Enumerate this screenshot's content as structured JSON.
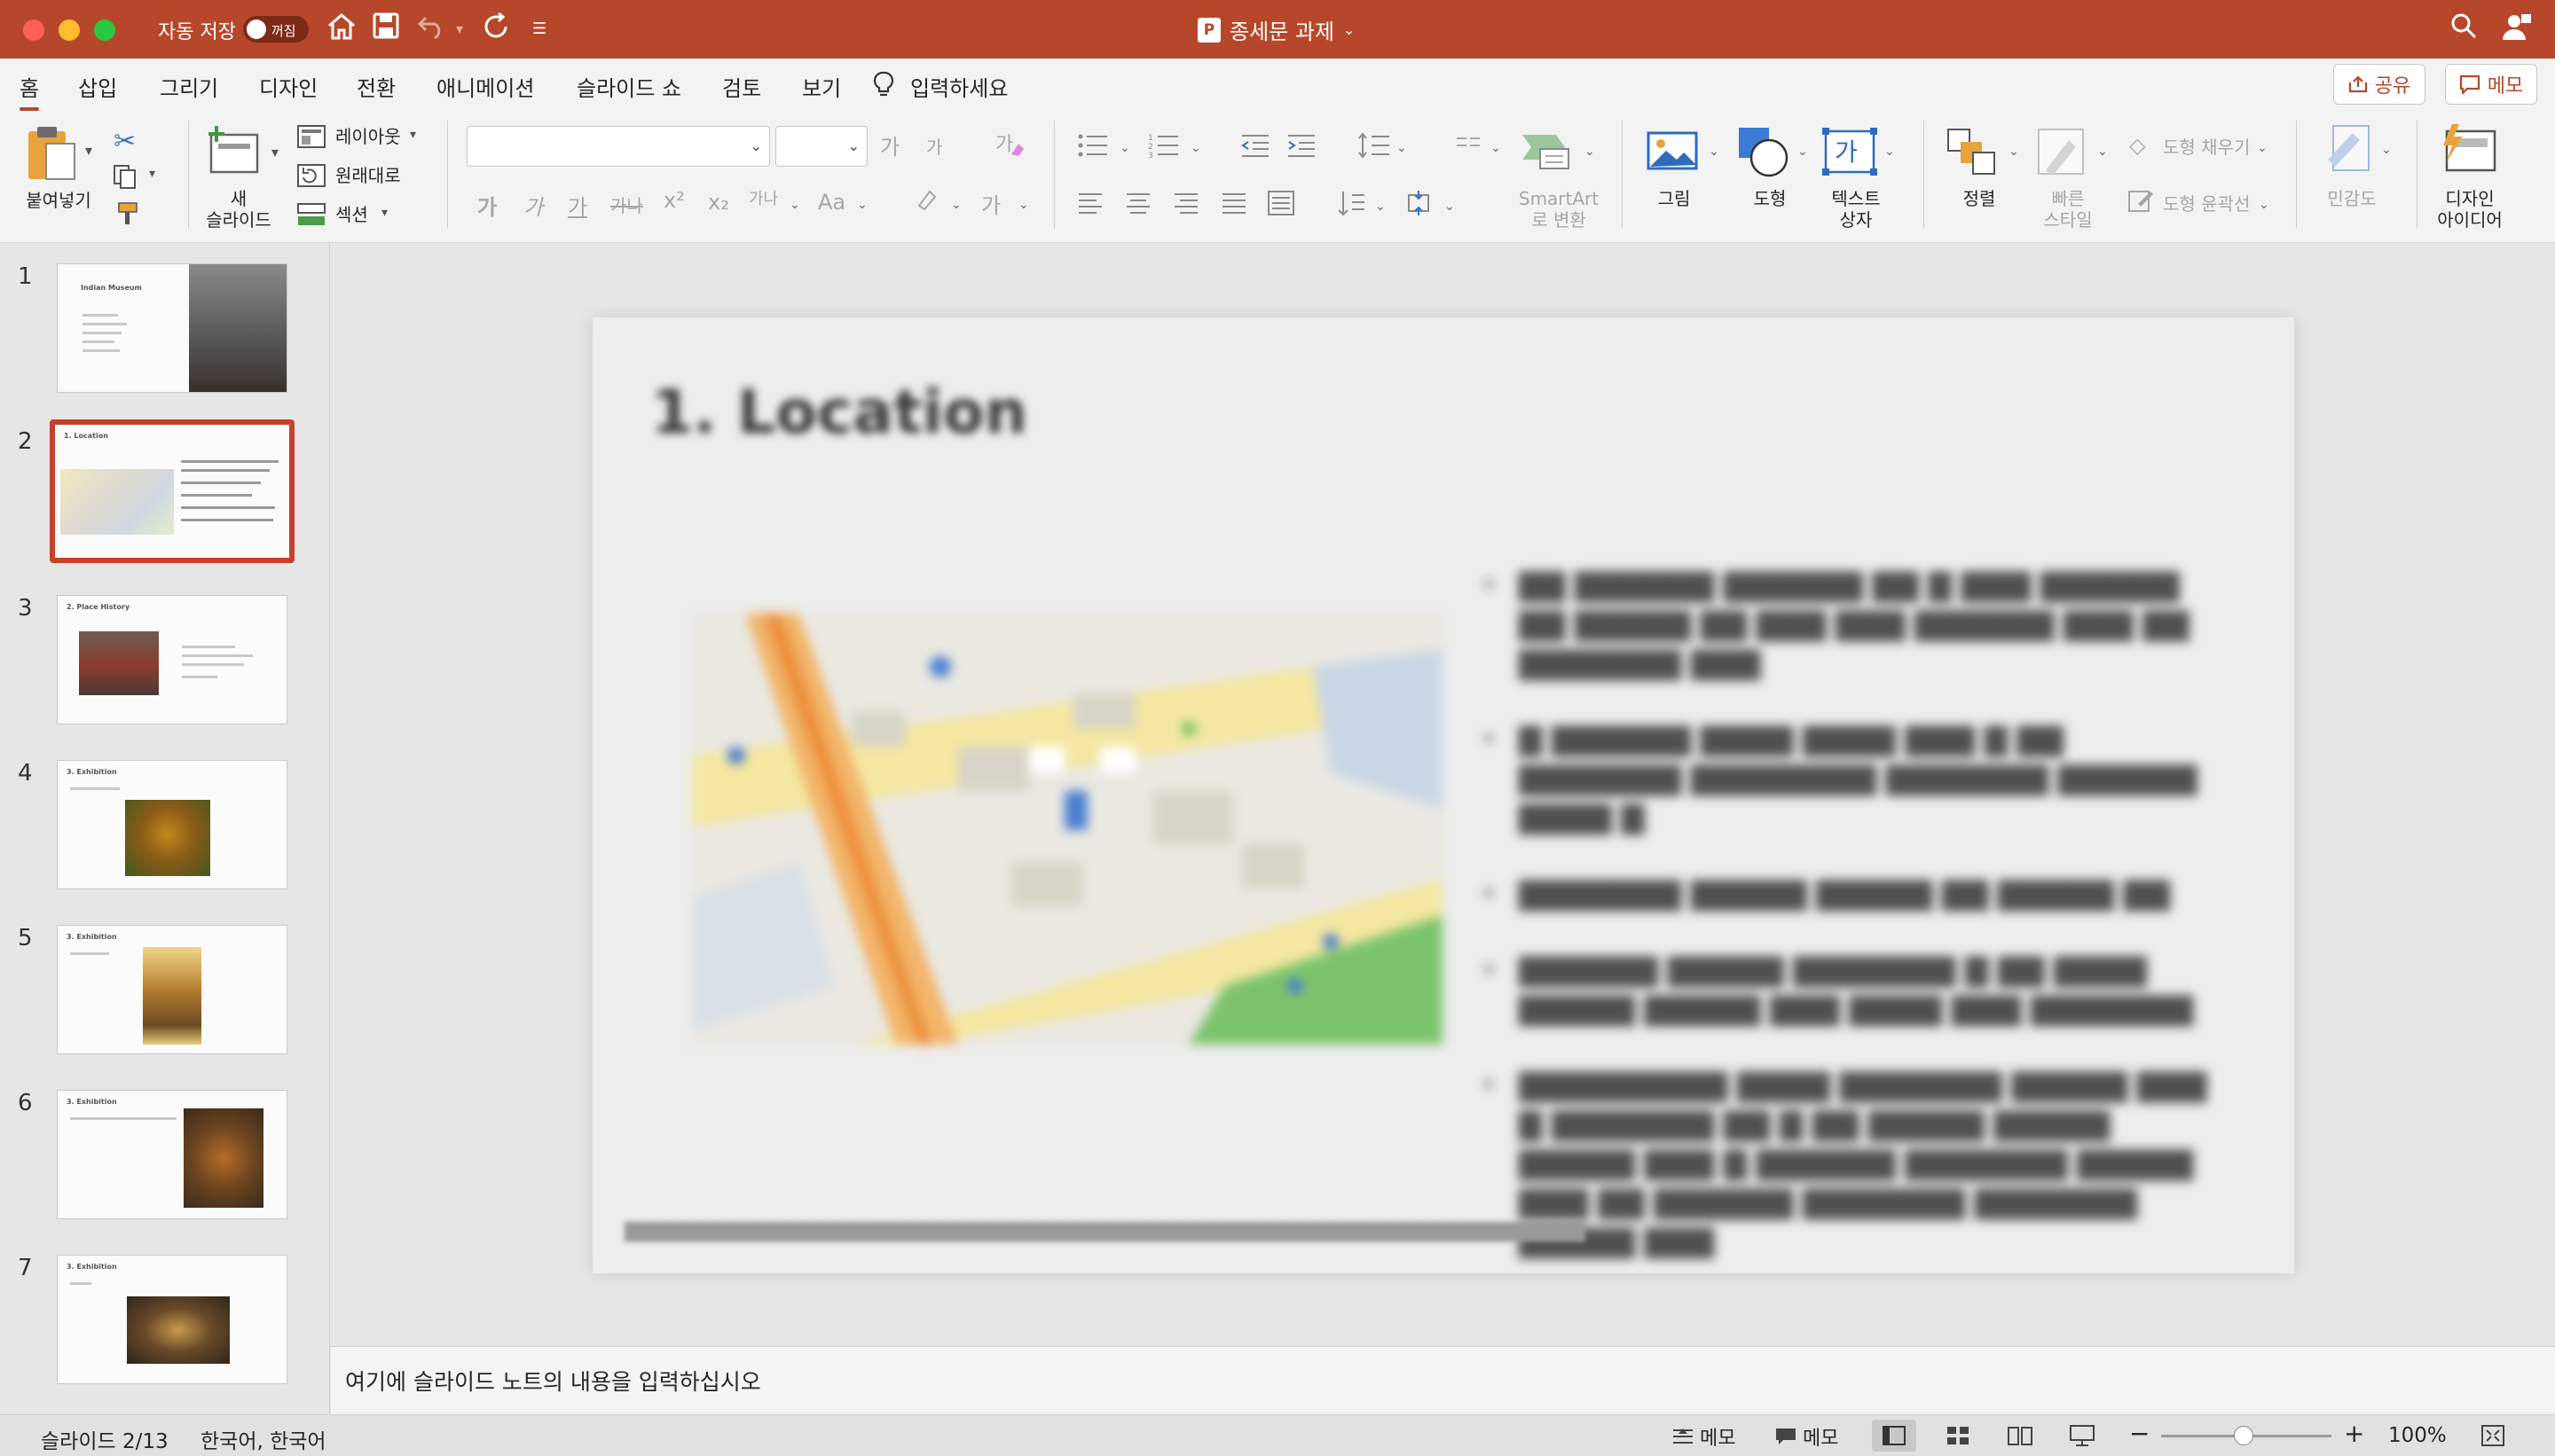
{
  "window": {
    "autosave_label": "자동 저장",
    "autosave_state": "꺼짐",
    "doc_title": "종세문 과제",
    "doc_icon": "P"
  },
  "tabs": [
    "홈",
    "삽입",
    "그리기",
    "디자인",
    "전환",
    "애니메이션",
    "슬라이드 쇼",
    "검토",
    "보기",
    "입력하세요"
  ],
  "active_tab": "홈",
  "buttons": {
    "share": "공유",
    "memo": "메모"
  },
  "ribbon": {
    "paste": "붙여넣기",
    "new_slide": "새\n슬라이드",
    "new_slide_l1": "새",
    "new_slide_l2": "슬라이드",
    "layout": "레이아웃",
    "reset": "원래대로",
    "section": "섹션",
    "smartart_l1": "SmartArt",
    "smartart_l2": "로 변환",
    "picture": "그림",
    "shape": "도형",
    "textbox_l1": "텍스트",
    "textbox_l2": "상자",
    "arrange": "정렬",
    "quick_style_l1": "빠른",
    "quick_style_l2": "스타일",
    "shape_fill": "도형 채우기",
    "shape_outline": "도형 윤곽선",
    "sensitivity": "민감도",
    "designer_l1": "디자인",
    "designer_l2": "아이디어",
    "font_size_up": "가",
    "font_size_down": "가",
    "format_glyphs": [
      "가",
      "가",
      "가",
      "가나",
      "x²",
      "x₂",
      "가나",
      "Aa"
    ],
    "font_color_glyph": "가",
    "textbox_glyph": "가"
  },
  "slides": [
    {
      "num": "1",
      "title": "Indian Museum"
    },
    {
      "num": "2",
      "title": "1. Location"
    },
    {
      "num": "3",
      "title": "2. Place History"
    },
    {
      "num": "4",
      "title": "3. Exhibition"
    },
    {
      "num": "5",
      "title": "3. Exhibition"
    },
    {
      "num": "6",
      "title": "3. Exhibition"
    },
    {
      "num": "7",
      "title": "3. Exhibition"
    }
  ],
  "selected_slide": 2,
  "current_slide": {
    "title": "1. Location"
  },
  "notes_placeholder": "여기에 슬라이드 노트의 내용을 입력하십시오",
  "status": {
    "slide_indicator": "슬라이드 2/13",
    "language": "한국어, 한국어",
    "notes_btn": "메모",
    "comments_btn": "메모",
    "zoom": "100%",
    "zoom_fraction": 0.5
  },
  "colors": {
    "accent": "#b7472a",
    "selected_thumb": "#c8412a"
  }
}
